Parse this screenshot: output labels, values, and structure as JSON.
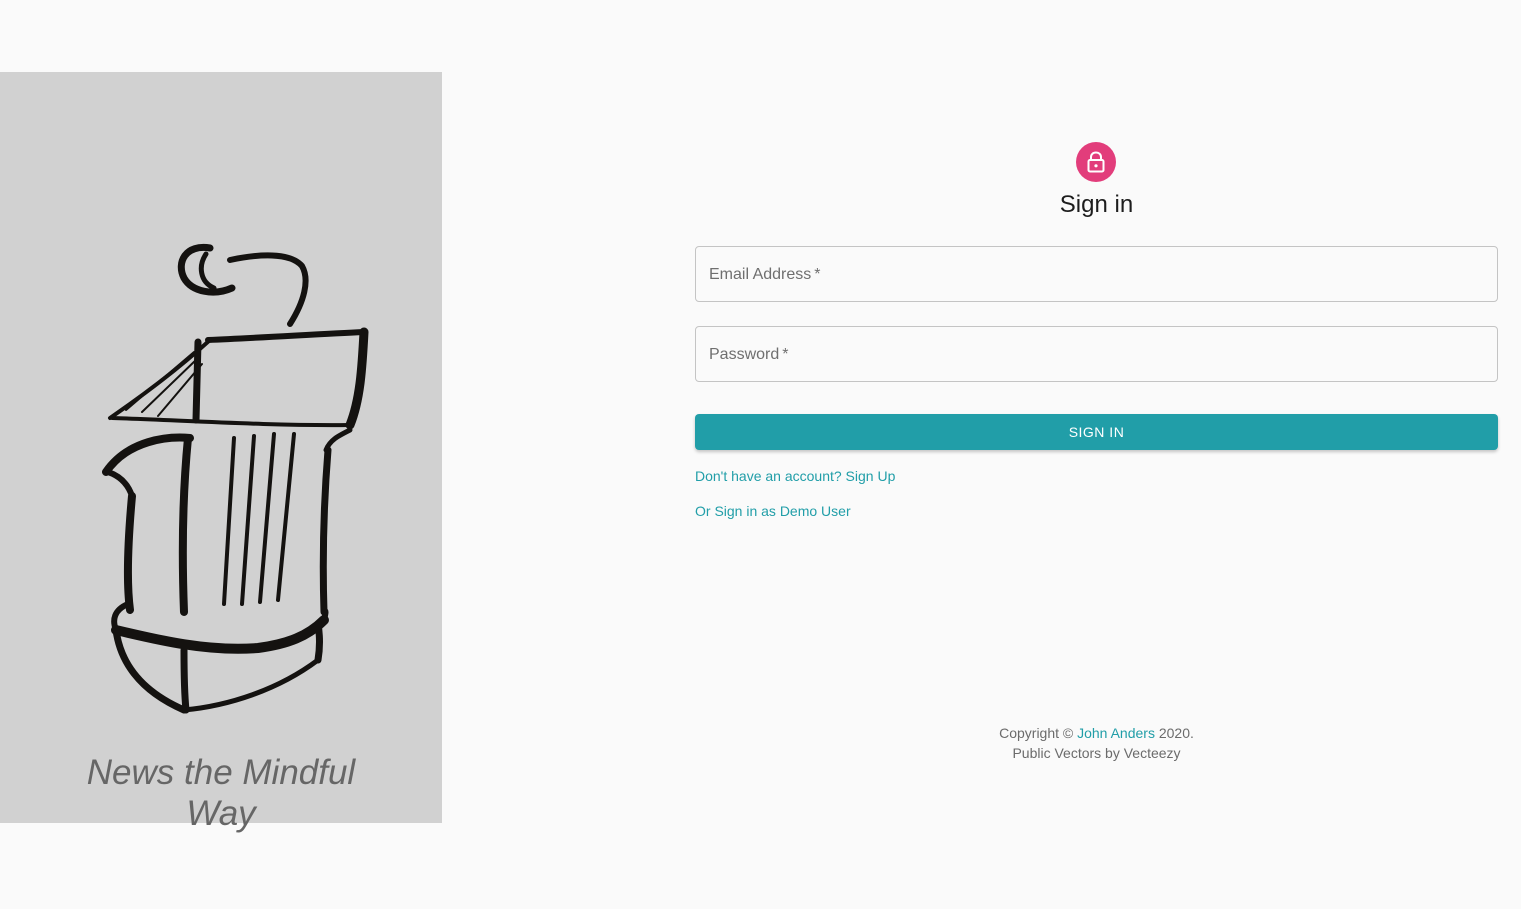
{
  "brand": {
    "tagline_line1": "News the Mindful",
    "tagline_line2": "Way",
    "illustration_icon": "podium-microphone-icon",
    "panel_color": "#d1d1d1"
  },
  "signin": {
    "avatar_icon": "lock-icon",
    "avatar_color": "#e23d7b",
    "title": "Sign in",
    "email_label": "Email Address",
    "password_label": "Password",
    "required_marker": "*",
    "email_value": "",
    "password_value": "",
    "button_label": "SIGN IN",
    "accent_color": "#219ea8",
    "signup_link": "Don't have an account? Sign Up",
    "demo_link": "Or Sign in as Demo User"
  },
  "footer": {
    "copyright_prefix": "Copyright ©",
    "author_link": "John Anders",
    "year": "2020.",
    "credits": "Public Vectors by Vecteezy"
  }
}
